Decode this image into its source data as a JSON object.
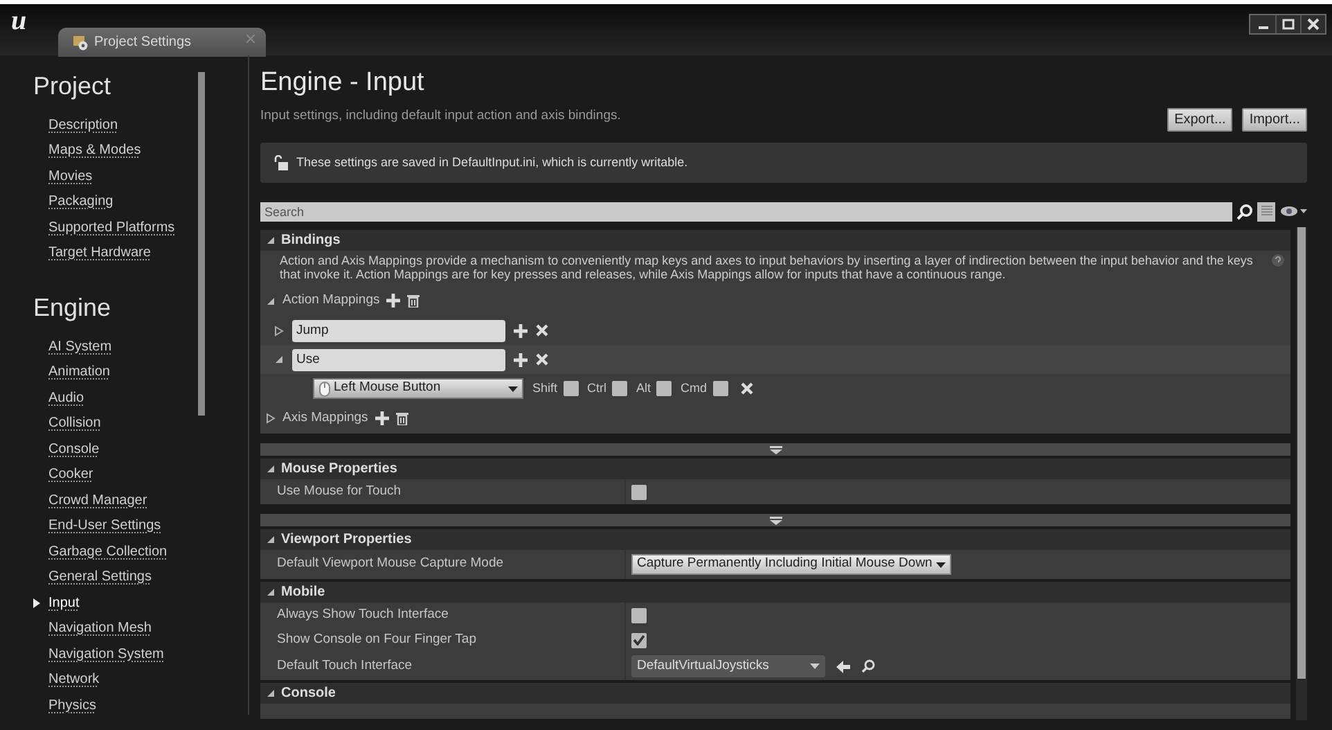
{
  "window": {
    "logo": "u",
    "tabs": [
      {
        "title": "Project Settings",
        "selected": true
      }
    ]
  },
  "sidebar": {
    "sections": [
      {
        "heading": "Project",
        "items": [
          {
            "label": "Description",
            "selected": false
          },
          {
            "label": "Maps & Modes",
            "selected": false
          },
          {
            "label": "Movies",
            "selected": false
          },
          {
            "label": "Packaging",
            "selected": false
          },
          {
            "label": "Supported Platforms",
            "selected": false
          },
          {
            "label": "Target Hardware",
            "selected": false
          }
        ]
      },
      {
        "heading": "Engine",
        "items": [
          {
            "label": "AI System",
            "selected": false
          },
          {
            "label": "Animation",
            "selected": false
          },
          {
            "label": "Audio",
            "selected": false
          },
          {
            "label": "Collision",
            "selected": false
          },
          {
            "label": "Console",
            "selected": false
          },
          {
            "label": "Cooker",
            "selected": false
          },
          {
            "label": "Crowd Manager",
            "selected": false
          },
          {
            "label": "End-User Settings",
            "selected": false
          },
          {
            "label": "Garbage Collection",
            "selected": false
          },
          {
            "label": "General Settings",
            "selected": false
          },
          {
            "label": "Input",
            "selected": true
          },
          {
            "label": "Navigation Mesh",
            "selected": false
          },
          {
            "label": "Navigation System",
            "selected": false
          },
          {
            "label": "Network",
            "selected": false
          },
          {
            "label": "Physics",
            "selected": false
          }
        ]
      }
    ]
  },
  "page": {
    "title": "Engine - Input",
    "subtitle": "Input settings, including default input action and axis bindings.",
    "buttons": [
      "Export...",
      "Import..."
    ],
    "notice": "These settings are saved in DefaultInput.ini, which is currently writable.",
    "search": {
      "placeholder": "Search"
    }
  },
  "categories": [
    {
      "title": "Bindings",
      "expanded": true,
      "advanced": true,
      "description": "Action and Axis Mappings provide a mechanism to conveniently map keys and axes to input behaviors by inserting a layer of indirection between the input behavior and the keys that invoke it. Action Mappings are for key presses and releases, while Axis Mappings allow for inputs that have a continuous range.",
      "groups": [
        {
          "label": "Action Mappings",
          "expanded": true,
          "mappings": [
            {
              "name": "Jump",
              "expanded": false
            },
            {
              "name": "Use",
              "expanded": true,
              "keys": [
                {
                  "key": "Left Mouse Button",
                  "modifiers": [
                    {
                      "label": "Shift",
                      "checked": false
                    },
                    {
                      "label": "Ctrl",
                      "checked": false
                    },
                    {
                      "label": "Alt",
                      "checked": false
                    },
                    {
                      "label": "Cmd",
                      "checked": false
                    }
                  ]
                }
              ]
            }
          ]
        },
        {
          "label": "Axis Mappings",
          "expanded": false
        }
      ]
    },
    {
      "title": "Mouse Properties",
      "expanded": true,
      "advanced": true,
      "rows": [
        {
          "kind": "checkbox",
          "label": "Use Mouse for Touch",
          "checked": false
        }
      ]
    },
    {
      "title": "Viewport Properties",
      "expanded": true,
      "advanced": false,
      "rows": [
        {
          "kind": "dropdown",
          "label": "Default Viewport Mouse Capture Mode",
          "value": "Capture Permanently Including Initial Mouse Down"
        }
      ]
    },
    {
      "title": "Mobile",
      "expanded": true,
      "advanced": false,
      "rows": [
        {
          "kind": "checkbox",
          "label": "Always Show Touch Interface",
          "checked": false
        },
        {
          "kind": "checkbox",
          "label": "Show Console on Four Finger Tap",
          "checked": true
        },
        {
          "kind": "asset",
          "label": "Default Touch Interface",
          "value": "DefaultVirtualJoysticks"
        }
      ]
    },
    {
      "title": "Console",
      "expanded": true,
      "advanced": false
    }
  ]
}
